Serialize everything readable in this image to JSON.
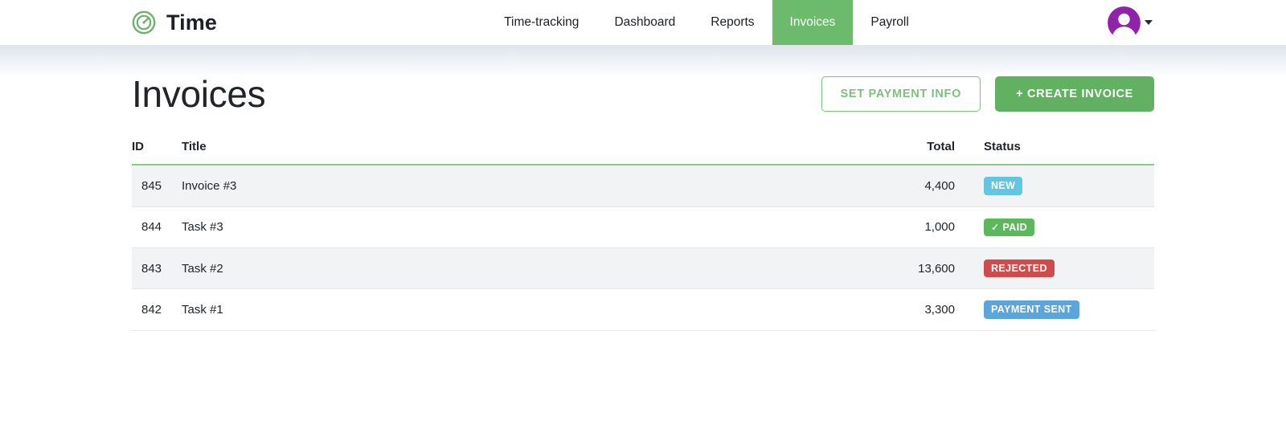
{
  "navbar": {
    "brand": {
      "icon": "gauge-logo-icon",
      "name": "Time"
    },
    "items": [
      {
        "label": "Time-tracking",
        "active": false
      },
      {
        "label": "Dashboard",
        "active": false
      },
      {
        "label": "Reports",
        "active": false
      },
      {
        "label": "Invoices",
        "active": true
      },
      {
        "label": "Payroll",
        "active": false
      }
    ],
    "account": {
      "avatar": "user-avatar-icon",
      "caret": "chevron-down-icon"
    }
  },
  "page": {
    "title": "Invoices"
  },
  "actions": {
    "set_payment_info": "SET PAYMENT INFO",
    "create_invoice": "+ CREATE INVOICE"
  },
  "table": {
    "columns": {
      "id": "ID",
      "title": "Title",
      "total": "Total",
      "status": "Status"
    },
    "rows": [
      {
        "id": "845",
        "title": "Invoice #3",
        "total": "4,400",
        "status": "NEW",
        "status_key": "new",
        "has_check": false
      },
      {
        "id": "844",
        "title": "Task #3",
        "total": "1,000",
        "status": "PAID",
        "status_key": "paid",
        "has_check": true
      },
      {
        "id": "843",
        "title": "Task #2",
        "total": "13,600",
        "status": "REJECTED",
        "status_key": "rejected",
        "has_check": false
      },
      {
        "id": "842",
        "title": "Task #1",
        "total": "3,300",
        "status": "PAYMENT SENT",
        "status_key": "payment-sent",
        "has_check": false
      }
    ]
  },
  "colors": {
    "brand_green": "#62b062",
    "nav_active": "#6cba6b",
    "outline_green": "#7fbf7c",
    "badge_new": "#62c6e0",
    "badge_paid": "#5cb85c",
    "badge_rejected": "#cf4c4c",
    "badge_payment_sent": "#5ba5dd",
    "avatar_purple": "#8e24aa",
    "row_stripe": "#f1f3f5"
  }
}
